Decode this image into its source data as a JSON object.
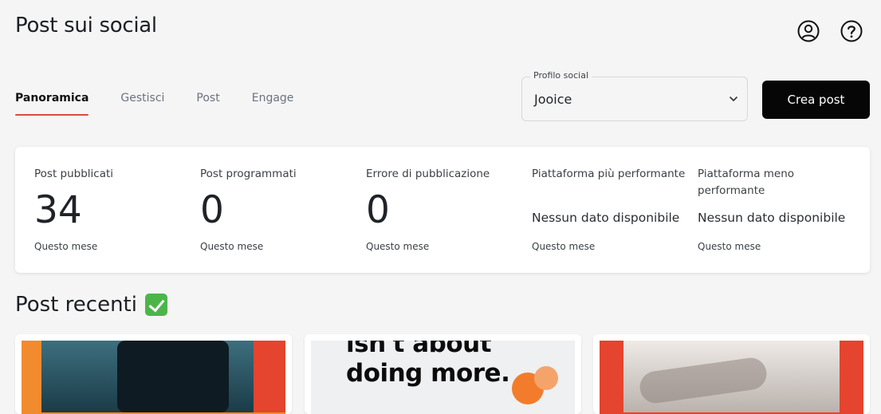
{
  "header": {
    "title": "Post sui social",
    "account_icon": "user-circle-icon",
    "help_icon": "help-circle-icon"
  },
  "tabs": [
    {
      "label": "Panoramica",
      "active": true
    },
    {
      "label": "Gestisci",
      "active": false
    },
    {
      "label": "Post",
      "active": false
    },
    {
      "label": "Engage",
      "active": false
    }
  ],
  "profile_select": {
    "label": "Profilo social",
    "value": "Jooice"
  },
  "create_button": {
    "label": "Crea post"
  },
  "stats": [
    {
      "label": "Post pubblicati",
      "value": "34",
      "period": "Questo mese"
    },
    {
      "label": "Post programmati",
      "value": "0",
      "period": "Questo mese"
    },
    {
      "label": "Errore di pubblicazione",
      "value": "0",
      "period": "Questo mese"
    },
    {
      "label": "Piattaforma più performante",
      "value": "Nessun dato disponibile",
      "period": "Questo mese"
    },
    {
      "label": "Piattaforma meno performante",
      "value": "Nessun dato disponibile",
      "period": "Questo mese"
    }
  ],
  "recent": {
    "title": "Post recenti",
    "emoji": "check-mark-icon",
    "cards": [
      {
        "image_text": ""
      },
      {
        "image_text": "isn't about\ndoing more."
      },
      {
        "image_text": ""
      }
    ]
  },
  "colors": {
    "accent_tab": "#e0483e",
    "cta_bg": "#060606",
    "check": "#4cb54a"
  }
}
